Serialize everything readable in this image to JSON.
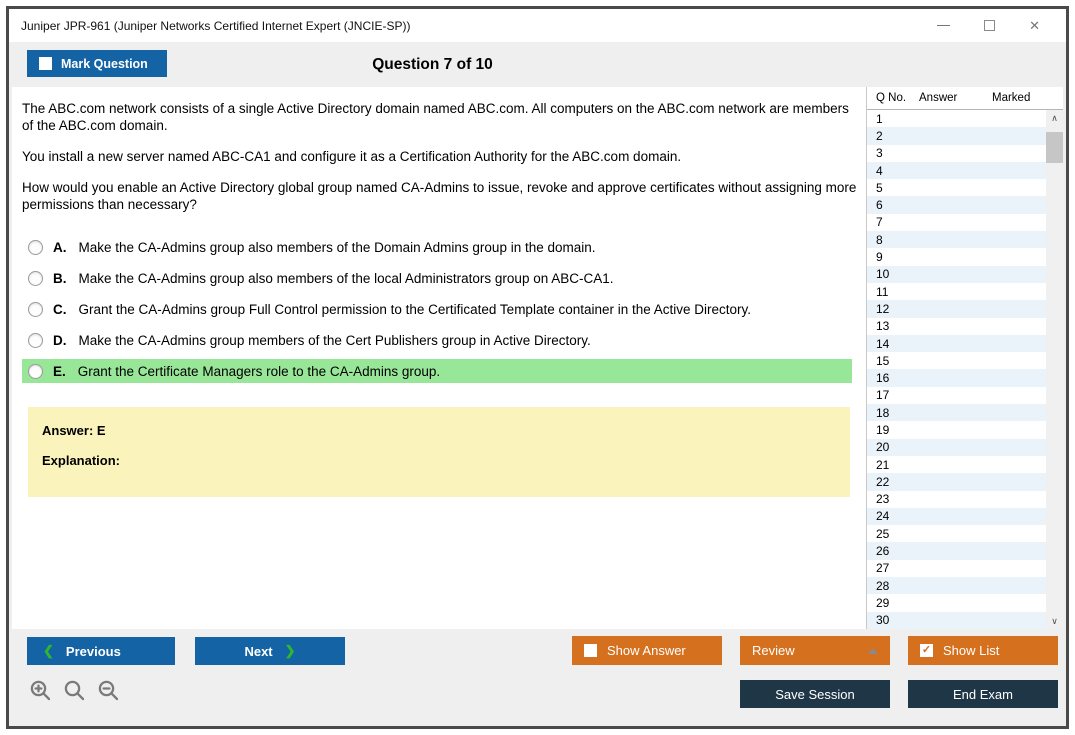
{
  "window": {
    "title": "Juniper JPR-961 (Juniper Networks Certified Internet Expert (JNCIE-SP))"
  },
  "icons": {
    "close": "✕",
    "check": "✓",
    "prev_chevron": "❮",
    "next_chevron": "❯",
    "scroll_up": "∧",
    "scroll_down": "∨"
  },
  "header": {
    "mark_question_label": "Mark Question",
    "mark_question_checked": false,
    "question_counter": "Question 7 of 10"
  },
  "question": {
    "paragraphs": [
      "The ABC.com network consists of a single Active Directory domain named ABC.com. All computers on the ABC.com network are members of the ABC.com domain.",
      "You install a new server named ABC-CA1 and configure it as a Certification Authority for the ABC.com domain.",
      "How would you enable an Active Directory global group named CA-Admins to issue, revoke and approve certificates without assigning more permissions than necessary?"
    ],
    "options": [
      {
        "letter": "A.",
        "text": "Make the CA-Admins group also members of the Domain Admins group in the domain.",
        "highlighted": false
      },
      {
        "letter": "B.",
        "text": "Make the CA-Admins group also members of the local Administrators group on ABC-CA1.",
        "highlighted": false
      },
      {
        "letter": "C.",
        "text": "Grant the CA-Admins group Full Control permission to the Certificated Template container in the Active Directory.",
        "highlighted": false
      },
      {
        "letter": "D.",
        "text": "Make the CA-Admins group members of the Cert Publishers group in Active Directory.",
        "highlighted": false
      },
      {
        "letter": "E.",
        "text": "Grant the Certificate Managers role to the CA-Admins group.",
        "highlighted": true
      }
    ],
    "answer_label": "Answer: E",
    "explanation_label": "Explanation:"
  },
  "question_list": {
    "columns": [
      "Q No.",
      "Answer",
      "Marked"
    ],
    "rows": [
      "1",
      "2",
      "3",
      "4",
      "5",
      "6",
      "7",
      "8",
      "9",
      "10",
      "11",
      "12",
      "13",
      "14",
      "15",
      "16",
      "17",
      "18",
      "19",
      "20",
      "21",
      "22",
      "23",
      "24",
      "25",
      "26",
      "27",
      "28",
      "29",
      "30"
    ]
  },
  "footer": {
    "previous_label": "Previous",
    "next_label": "Next",
    "show_answer_label": "Show Answer",
    "show_answer_checked": false,
    "review_label": "Review",
    "show_list_label": "Show List",
    "show_list_checked": true,
    "save_session_label": "Save Session",
    "end_exam_label": "End Exam"
  },
  "colors": {
    "accent_blue": "#1464a5",
    "accent_orange": "#d5701f",
    "accent_navy": "#1f3647",
    "highlight_green": "#98e698",
    "answer_yellow": "#faf3bc",
    "alt_row_blue": "#eaf3fa"
  }
}
